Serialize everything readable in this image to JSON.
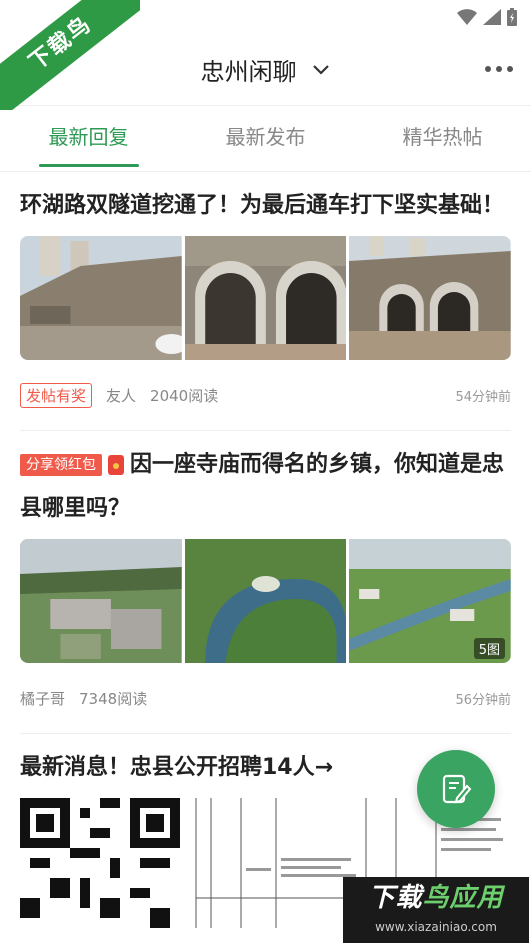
{
  "watermark": {
    "ribbon_text": "下载鸟",
    "logo_main_white": "下载",
    "logo_main_green": "鸟应用",
    "logo_url": "www.xiazainiao.com"
  },
  "header": {
    "title": "忠州闲聊"
  },
  "tabs": [
    {
      "label": "最新回复",
      "active": true
    },
    {
      "label": "最新发布",
      "active": false
    },
    {
      "label": "精华热帖",
      "active": false
    }
  ],
  "posts": [
    {
      "title": "环湖路双隧道挖通了！为最后通车打下坚实基础！",
      "badge": "发帖有奖",
      "author": "友人",
      "views": "2040阅读",
      "time": "54分钟前"
    },
    {
      "tag": "分享领红包",
      "title": "因一座寺庙而得名的乡镇，你知道是忠县哪里吗？",
      "image_count": "5图",
      "author": "橘子哥",
      "views": "7348阅读",
      "time": "56分钟前"
    },
    {
      "title": "最新消息！忠县公开招聘14人→"
    }
  ],
  "colors": {
    "accent": "#2f9a55",
    "fab": "#3aa463",
    "badge": "#f05a4a"
  }
}
